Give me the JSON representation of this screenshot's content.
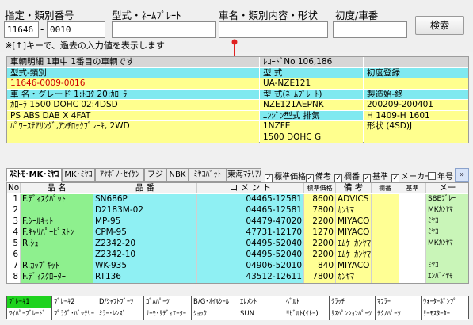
{
  "search": {
    "label_model_no": "指定・類別番号",
    "label_model_plate": "型式・ﾈｰﾑﾌﾟﾚｰﾄ",
    "label_vehicle_name": "車名・類別内容・形状",
    "label_reg_no": "初度/車番",
    "model_no_value": "11646",
    "class_no_value": "0010",
    "model_plate_value": "",
    "vehicle_name_value": "",
    "reg_no_value": "",
    "separator": "-",
    "search_button": "検索",
    "hint": "※[↑]キーで、過去の入力値を表示します"
  },
  "info": {
    "left": [
      "車輌明細 1車中 1番目の車輌です",
      "型式-類別",
      "11646-0009-0016",
      "車 名・グレード 1:ﾄﾖﾀ 20:ｶﾛｰﾗ",
      "ｶﾛｰﾗ 1500 DOHC    02:4DSD",
      "PS ABS DAB X 4FAT",
      "ﾊﾟﾜｰｽﾃｱﾘﾝｸﾞ,ｱﾝﾁﾛｯｸﾌﾞﾚｰｷ, 2WD",
      ""
    ],
    "mid": [
      "ﾚｺｰﾄﾞNo 106,186",
      "型 式",
      "UA-NZE121",
      "型 式(ﾈｰﾑﾌﾟﾚｰﾄ)",
      "NZE121AEPNK",
      "ｴﾝｼﾞﾝ型式 排気",
      "1NZFE",
      "1500 DOHC G"
    ],
    "right": [
      "",
      "初度登録",
      "",
      "製造始-終",
      "200209-200401",
      "H 1409-H 1601",
      "形状  (4SD)J",
      ""
    ]
  },
  "tabs": [
    "ｽﾐﾄﾓ･MK･ﾐﾔｺ",
    "MK･ﾐﾔｺ",
    "ｱｹﾎﾞﾉ･ｾｲｹﾝ",
    "フジ",
    "NBK",
    "ﾐﾔｺﾊﾟｯﾄ",
    "東海ﾏﾃﾘｱﾙ"
  ],
  "checks": [
    {
      "label": "標準価格",
      "checked": true
    },
    {
      "label": "備考",
      "checked": true
    },
    {
      "label": "欄番",
      "checked": true
    },
    {
      "label": "基準",
      "checked": true
    },
    {
      "label": "メーカー",
      "checked": true
    },
    {
      "label": "年号",
      "checked": false
    }
  ],
  "more_label": "»",
  "grid": {
    "headers": [
      "No",
      "品 名",
      "品 番",
      "コ メ ン ト",
      "標準価格",
      "備 考",
      "欄番",
      "基準",
      "メー"
    ],
    "rows": [
      {
        "no": "1",
        "name": "F.ﾃﾞｨｽｸﾊﾟｯﾄ",
        "part": "SN686P",
        "comment": "04465-12581",
        "price": "8600",
        "note": "ADVICS",
        "ran": "",
        "std": "",
        "maker": "S8Eﾌﾞﾚｰ"
      },
      {
        "no": "2",
        "name": "",
        "part": "D2183M-02",
        "comment": "04465-12581",
        "price": "7800",
        "note": "ｶﾝﾔﾏ",
        "ran": "",
        "std": "",
        "maker": "MKｶﾝﾔﾏ"
      },
      {
        "no": "3",
        "name": "F.ｼｰﾙｷｯﾄ",
        "part": "MP-95",
        "comment": "04479-47020",
        "price": "2200",
        "note": "MIYACO",
        "ran": "",
        "std": "",
        "maker": "ﾐﾔｺ"
      },
      {
        "no": "4",
        "name": "F.ｷｬﾘﾊﾟｰﾋﾟｽﾄﾝ",
        "part": "CPM-95",
        "comment": "47731-12170",
        "price": "1270",
        "note": "MIYACO",
        "ran": "",
        "std": "",
        "maker": "ﾐﾔｺ"
      },
      {
        "no": "5",
        "name": "R.ｼｭｰ",
        "part": "Z2342-20",
        "comment": "04495-52040",
        "price": "2200",
        "note": "ｴﾑｹｰｶﾝﾔﾏ",
        "ran": "",
        "std": "",
        "maker": "MKｶﾝﾔﾏ"
      },
      {
        "no": "6",
        "name": "",
        "part": "Z2342-10",
        "comment": "04495-52040",
        "price": "2200",
        "note": "ｴﾑｹｰｶﾝﾔﾏ",
        "ran": "",
        "std": "",
        "maker": ""
      },
      {
        "no": "7",
        "name": "R.ｶｯﾌﾟｷｯﾄ",
        "part": "WK-935",
        "comment": "04906-52010",
        "price": "840",
        "note": "MIYACO",
        "ran": "",
        "std": "",
        "maker": "ﾐﾔｺ"
      },
      {
        "no": "8",
        "name": "F.ﾃﾞｨｽｸﾛｰﾀｰ",
        "part": "RT136",
        "comment": "43512-12611",
        "price": "7800",
        "note": "ｶﾝﾔﾏ",
        "ran": "",
        "std": "",
        "maker": "ｴﾝﾊﾞｲﾔﾓ"
      }
    ]
  },
  "categories": [
    [
      "ﾌﾞﾚｰｷ1",
      "ﾌﾞﾚｰｷ2",
      "D/ｼｬﾌﾄﾌﾞｰﾂ",
      "ｺﾞﾑﾊﾟｰﾂ",
      "B/G･ｵｲﾙｼｰﾙ",
      "ｴﾚﾒﾝﾄ",
      "ﾍﾞﾙﾄ",
      "ｸﾗｯﾁ",
      "ﾏﾌﾗｰ",
      "ｳｫｰﾀｰﾎﾟﾝﾌﾟ"
    ],
    [
      "ﾜｲﾊﾟｰﾌﾞﾚｰﾄﾞ",
      "ﾌﾟﾗｸﾞ･ﾊﾞｯﾃﾘｰ",
      "ﾐﾗｰ･ﾚﾝｽﾞ",
      "ｻｰﾓ･ｻﾃﾞｨｴｰﾀｰ",
      "ｼｮｯｸ",
      "SUN",
      "ﾘﾋﾞﾙﾄ(ｲﾄｰ)",
      "ｻｽﾍﾟﾝｼｮﾝﾊﾟｰﾂ",
      "ﾃｸﾉﾊﾟｰﾂ",
      "ｻｰﾓｽﾀｰﾀｰ"
    ]
  ]
}
